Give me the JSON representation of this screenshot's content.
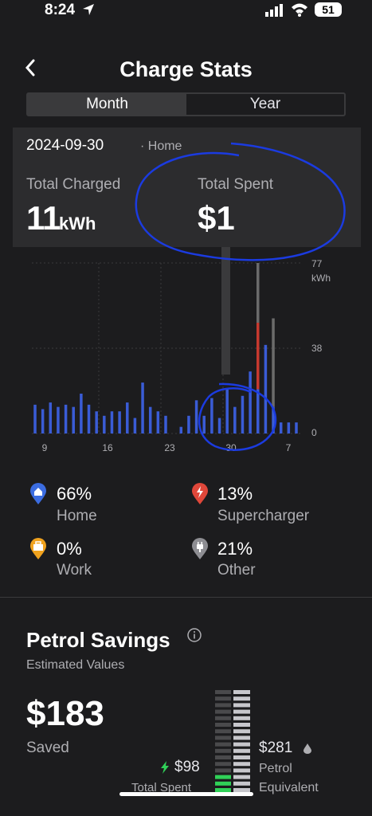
{
  "status": {
    "time": "8:24",
    "battery": "51"
  },
  "header": {
    "title": "Charge Stats"
  },
  "tabs": [
    {
      "label": "Month"
    },
    {
      "label": "Year"
    }
  ],
  "summary": {
    "date": "2024-09-30",
    "location": "· Home",
    "total_charged_label": "Total Charged",
    "total_charged_value": "11",
    "total_charged_unit": "kWh",
    "total_spent_label": "Total Spent",
    "total_spent_value": "$1"
  },
  "chart_data": {
    "type": "bar",
    "x_tick_labels": [
      "9",
      "16",
      "23",
      "30",
      "7"
    ],
    "y_tick_labels": [
      "77",
      "38",
      "0"
    ],
    "y_unit": "kWh",
    "ylim": [
      0,
      77
    ],
    "grid": true,
    "series": [
      {
        "color": "#3a5cd6",
        "values": [
          13,
          11,
          14,
          12,
          13,
          12,
          18,
          13,
          10,
          8,
          10,
          10,
          14,
          7,
          23,
          12,
          10,
          8,
          0,
          3,
          8,
          15,
          8,
          16,
          7,
          20,
          12,
          17,
          28,
          20,
          40,
          12,
          5,
          5,
          5
        ]
      },
      {
        "color": "#c7392f",
        "values": [
          0,
          0,
          0,
          0,
          0,
          0,
          0,
          0,
          0,
          0,
          0,
          0,
          0,
          0,
          0,
          0,
          0,
          0,
          0,
          0,
          0,
          0,
          0,
          0,
          0,
          0,
          0,
          0,
          0,
          30,
          0,
          0,
          0,
          0,
          0
        ]
      },
      {
        "color": "#6b6b6b",
        "values": [
          0,
          0,
          0,
          0,
          0,
          0,
          0,
          0,
          0,
          0,
          0,
          0,
          0,
          0,
          0,
          0,
          0,
          0,
          0,
          0,
          0,
          0,
          0,
          0,
          0,
          0,
          0,
          0,
          0,
          27,
          0,
          40,
          0,
          0,
          0
        ]
      }
    ]
  },
  "legend": [
    {
      "pct": "66%",
      "name": "Home",
      "color": "#3b6ce0",
      "icon": "home-icon"
    },
    {
      "pct": "13%",
      "name": "Supercharger",
      "color": "#e0473a",
      "icon": "bolt-icon"
    },
    {
      "pct": "0%",
      "name": "Work",
      "color": "#f0a21e",
      "icon": "briefcase-icon"
    },
    {
      "pct": "21%",
      "name": "Other",
      "color": "#8e8e93",
      "icon": "plug-icon"
    }
  ],
  "petrol": {
    "title": "Petrol Savings",
    "subtitle": "Estimated Values",
    "saved_value": "$183",
    "saved_label": "Saved",
    "spent_value": "$98",
    "spent_label": "Total Spent",
    "petrol_value": "$281",
    "petrol_label_1": "Petrol",
    "petrol_label_2": "Equivalent",
    "spent_fraction": 0.35,
    "accent": "#30d158"
  }
}
